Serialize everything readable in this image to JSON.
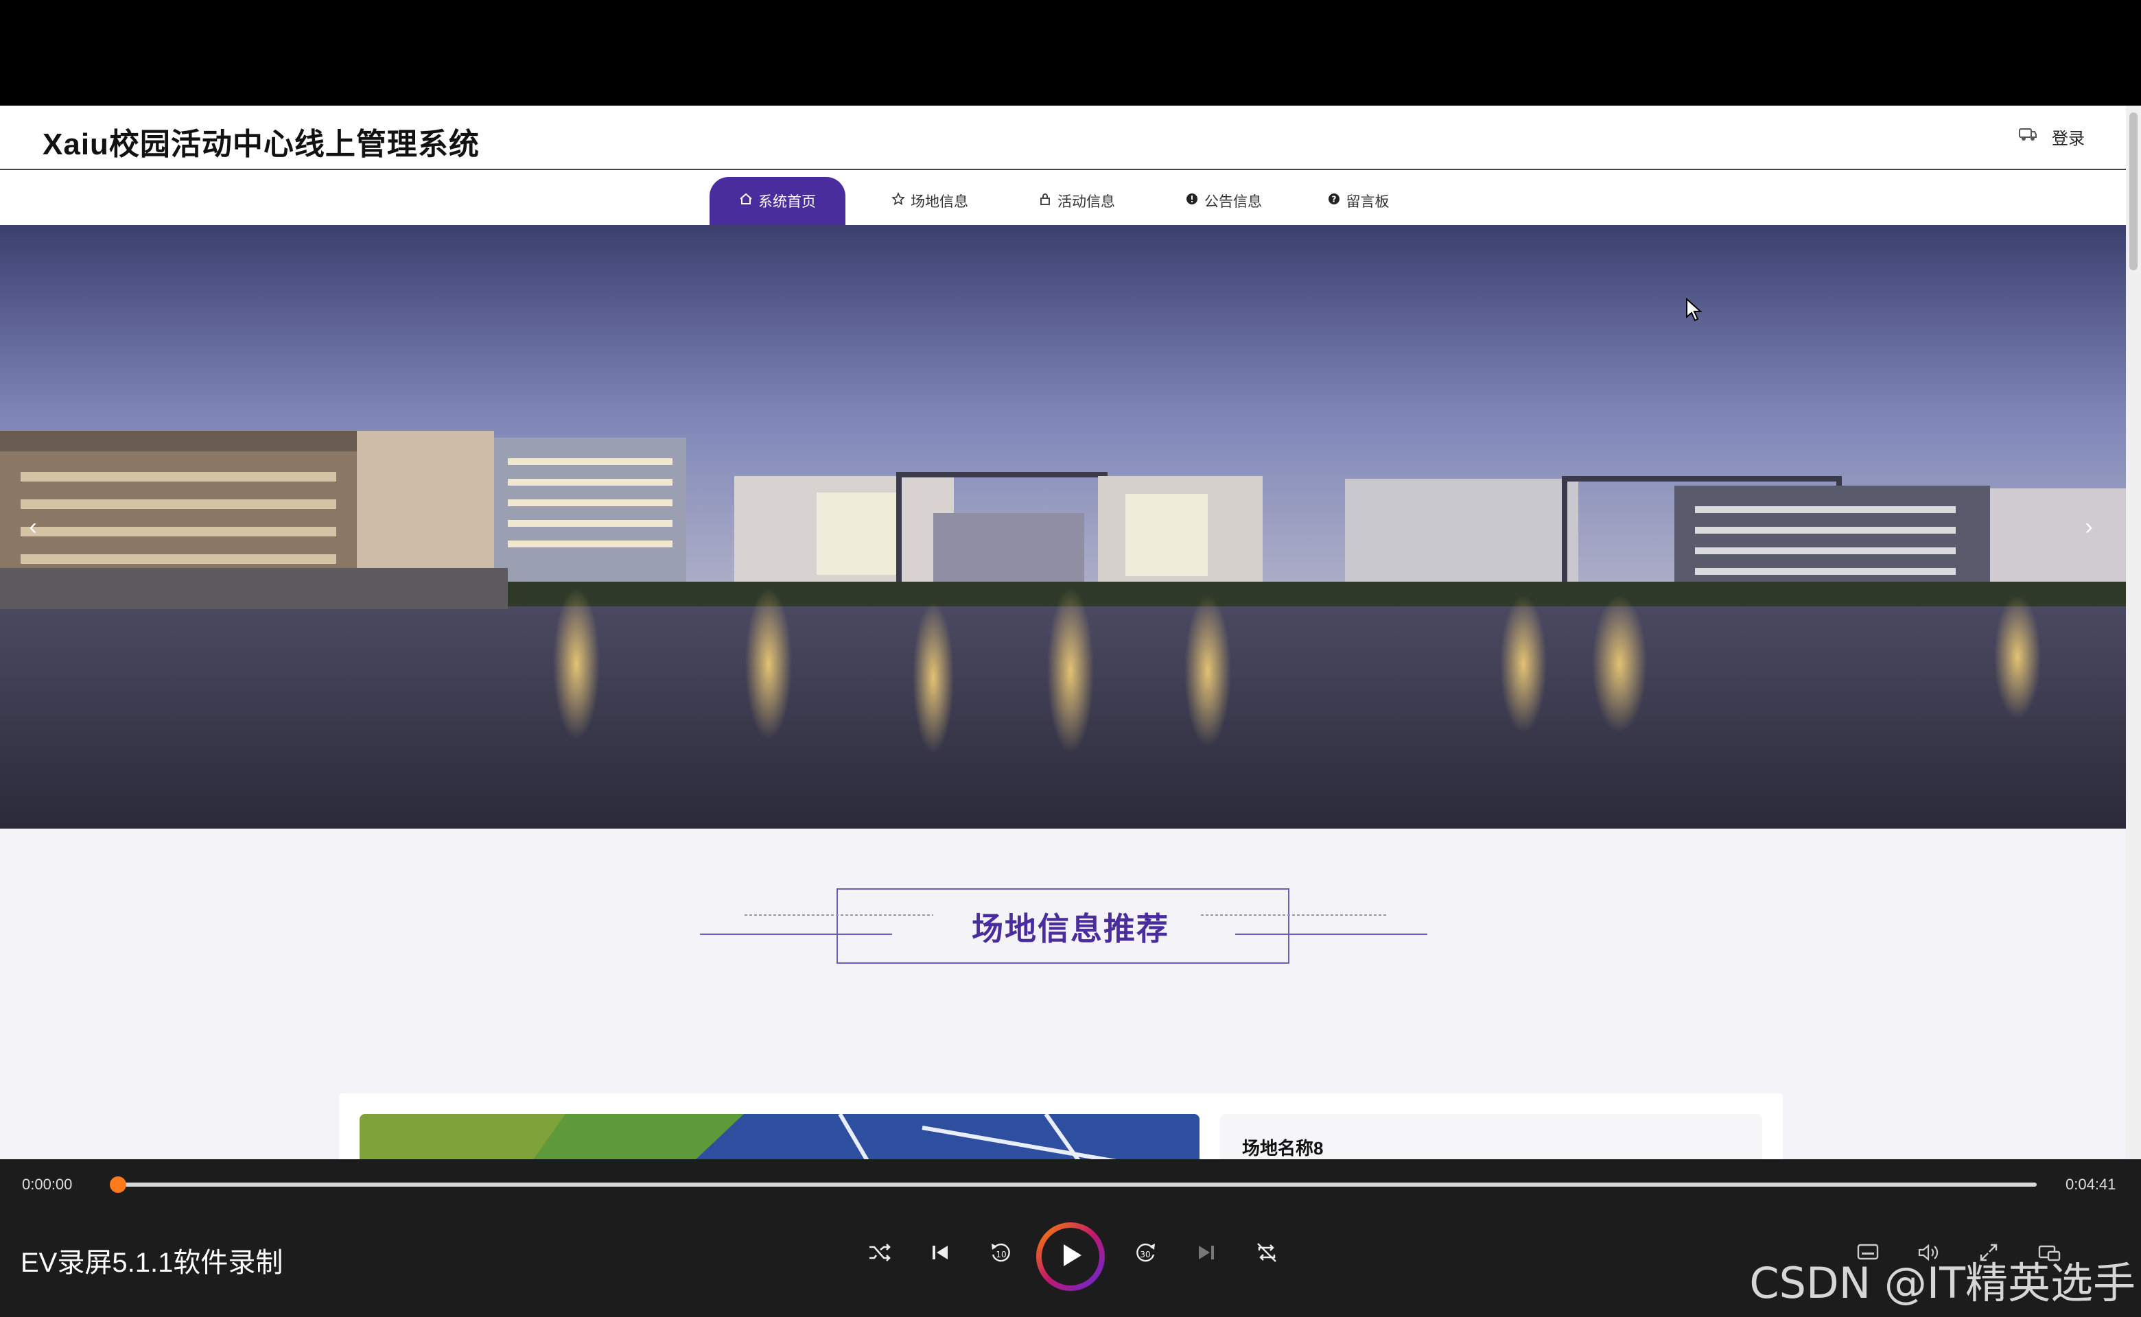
{
  "site": {
    "title": "Xaiu校园活动中心线上管理系统",
    "login_label": "登录"
  },
  "nav": {
    "items": [
      {
        "label": "系统首页",
        "icon": "home-icon",
        "active": true
      },
      {
        "label": "场地信息",
        "icon": "star-icon",
        "active": false
      },
      {
        "label": "活动信息",
        "icon": "lock-icon",
        "active": false
      },
      {
        "label": "公告信息",
        "icon": "info-icon",
        "active": false
      },
      {
        "label": "留言板",
        "icon": "question-icon",
        "active": false
      }
    ]
  },
  "banner": {
    "prev_arrow": "‹",
    "next_arrow": "›"
  },
  "section": {
    "title": "场地信息推荐"
  },
  "venue_card": {
    "name": "场地名称8"
  },
  "player": {
    "current_time": "0:00:00",
    "total_time": "0:04:41",
    "progress": 0,
    "recorder_label": "EV录屏5.1.1软件录制",
    "watermark": "CSDN @IT精英选手"
  },
  "colors": {
    "accent": "#4a2d9c",
    "progress": "#ff7a1a",
    "player_bg": "#1c1c1c"
  }
}
